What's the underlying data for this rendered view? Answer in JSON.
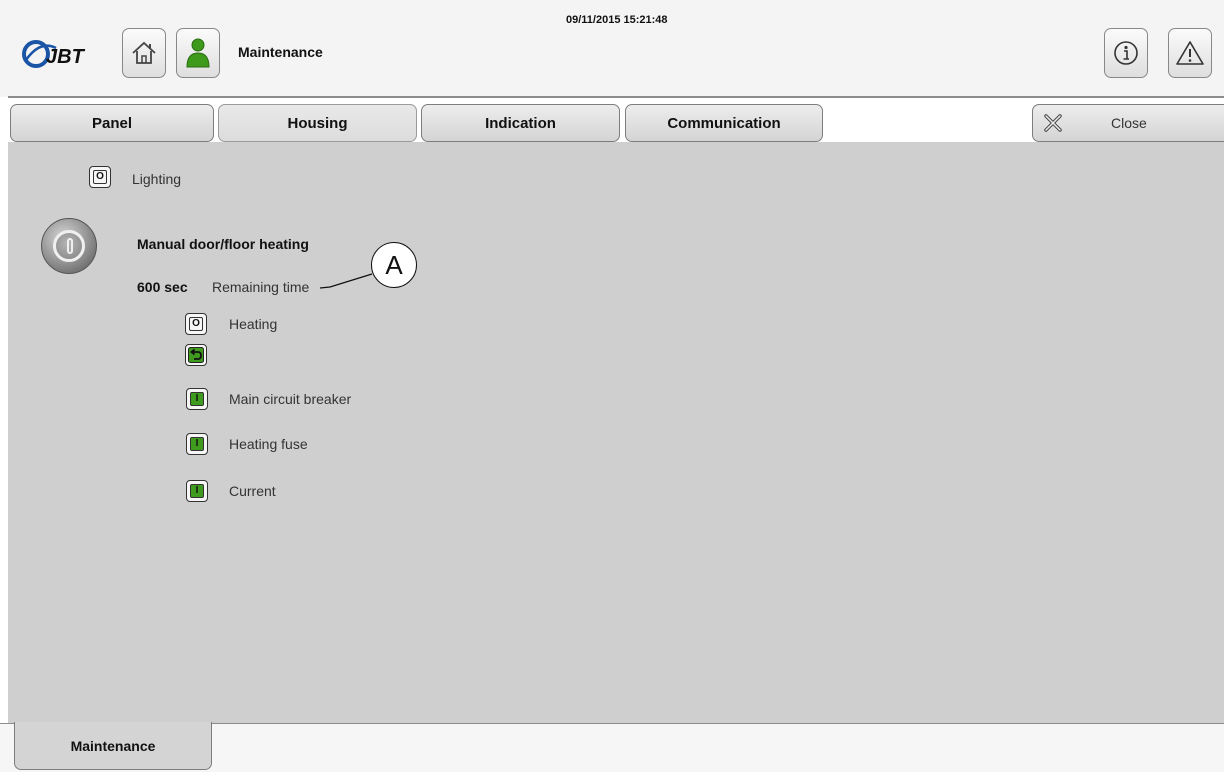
{
  "header": {
    "logo_text": "JBT",
    "page_title": "Maintenance",
    "datetime": "09/11/2015 15:21:48",
    "icons": [
      "home-icon",
      "user-icon",
      "info-icon",
      "warning-icon"
    ]
  },
  "tabs": [
    {
      "label": "Panel"
    },
    {
      "label": "Housing"
    },
    {
      "label": "Indication"
    },
    {
      "label": "Communication"
    }
  ],
  "close": {
    "label": "Close"
  },
  "lighting": {
    "label": "Lighting",
    "state": "O"
  },
  "heating_section": {
    "title": "Manual door/floor heating",
    "time_value": "600 sec",
    "time_label": "Remaining time",
    "callout": "A"
  },
  "indicators": [
    {
      "label": "Heating",
      "state": "O"
    },
    {
      "label": "Main circuit breaker",
      "state": "I"
    },
    {
      "label": "Heating fuse",
      "state": "I"
    },
    {
      "label": "Current",
      "state": "I"
    }
  ],
  "footer": {
    "tab_label": "Maintenance"
  },
  "colors": {
    "active_green": "#3f9b1e",
    "user_icon_green": "#3e9a1b",
    "panel_gray": "#cfcfcf",
    "logo_blue": "#1a55a6"
  }
}
